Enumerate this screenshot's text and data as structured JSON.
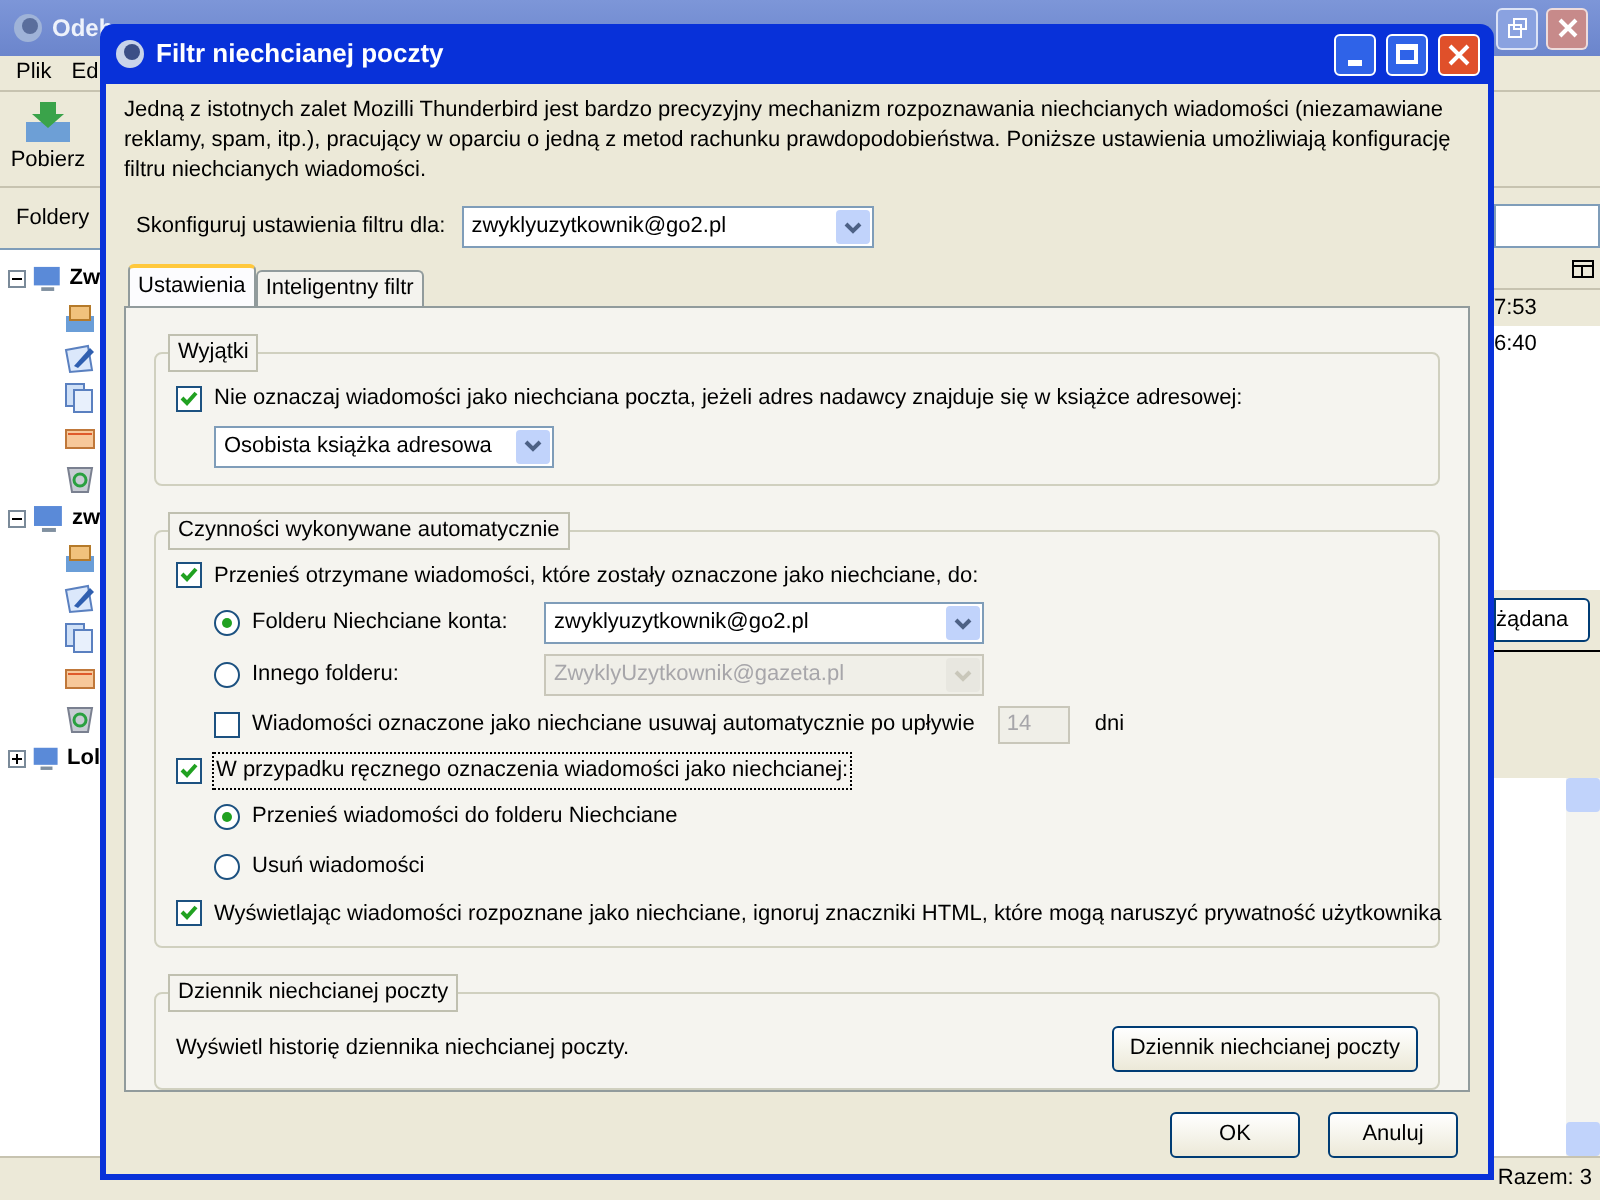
{
  "app": {
    "title": "Odeb",
    "menu": [
      "Plik",
      "Ed"
    ],
    "get_button": "Pobierz",
    "folders_label": "Foldery",
    "tree": [
      {
        "label": "Zw",
        "expanded": true,
        "children": [
          {
            "kind": "inbox"
          },
          {
            "kind": "drafts"
          },
          {
            "kind": "templates"
          },
          {
            "kind": "unsent"
          },
          {
            "kind": "trash"
          }
        ]
      },
      {
        "label": "zw",
        "expanded": true,
        "children": [
          {
            "kind": "inbox"
          },
          {
            "kind": "drafts"
          },
          {
            "kind": "templates"
          },
          {
            "kind": "unsent"
          },
          {
            "kind": "trash"
          }
        ]
      },
      {
        "label": "Lol",
        "expanded": false
      }
    ],
    "times": [
      "7:53",
      "6:40"
    ],
    "junk_button": "żądana",
    "status": "Razem: 3"
  },
  "dialog": {
    "title": "Filtr niechcianej poczty",
    "description": "Jedną z istotnych zalet Mozilli Thunderbird jest bardzo precyzyjny mechanizm rozpoznawania niechcianych wiadomości (niezamawiane reklamy, spam, itp.), pracujący w oparciu o jedną z metod rachunku prawdopodobieństwa. Poniższe ustawienia umożliwiają konfigurację filtru niechcianych wiadomości.",
    "account_label": "Skonfiguruj ustawienia filtru dla:",
    "account_value": "zwyklyuzytkownik@go2.pl",
    "tabs": [
      {
        "label": "Ustawienia",
        "selected": true
      },
      {
        "label": "Inteligentny filtr",
        "selected": false
      }
    ],
    "exceptions": {
      "legend": "Wyjątki",
      "whitelist": {
        "label": "Nie oznaczaj wiadomości jako niechciana poczta, jeżeli adres nadawcy znajduje się w książce adresowej:",
        "checked": true
      },
      "address_book": "Osobista książka adresowa"
    },
    "actions": {
      "legend": "Czynności wykonywane automatycznie",
      "move": {
        "label": "Przenieś otrzymane wiadomości, które zostały oznaczone jako niechciane, do:",
        "checked": true
      },
      "destinations": [
        {
          "label": "Folderu Niechciane konta:",
          "selected": true,
          "value": "zwyklyuzytkownik@go2.pl",
          "disabled": false
        },
        {
          "label": "Innego folderu:",
          "selected": false,
          "value": "ZwyklyUzytkownik@gazeta.pl",
          "disabled": true
        }
      ],
      "purge": {
        "label": "Wiadomości oznaczone jako niechciane usuwaj automatycznie po upływie",
        "checked": false,
        "days": "14",
        "unit": "dni",
        "disabled": true
      },
      "manual": {
        "label": "W przypadku ręcznego oznaczenia wiadomości jako niechcianej:",
        "checked": true,
        "focused": true
      },
      "manual_options": [
        {
          "label": "Przenieś wiadomości do folderu Niechciane",
          "selected": true
        },
        {
          "label": "Usuń wiadomości",
          "selected": false
        }
      ],
      "ignore_html": {
        "label": "Wyświetlając wiadomości rozpoznane jako niechciane, ignoruj znaczniki HTML, które mogą naruszyć prywatność użytkownika",
        "checked": true
      }
    },
    "log": {
      "legend": "Dziennik niechcianej poczty",
      "text": "Wyświetl historię dziennika niechcianej poczty.",
      "button": "Dziennik niechcianej poczty"
    },
    "buttons": [
      "OK",
      "Anuluj"
    ]
  }
}
